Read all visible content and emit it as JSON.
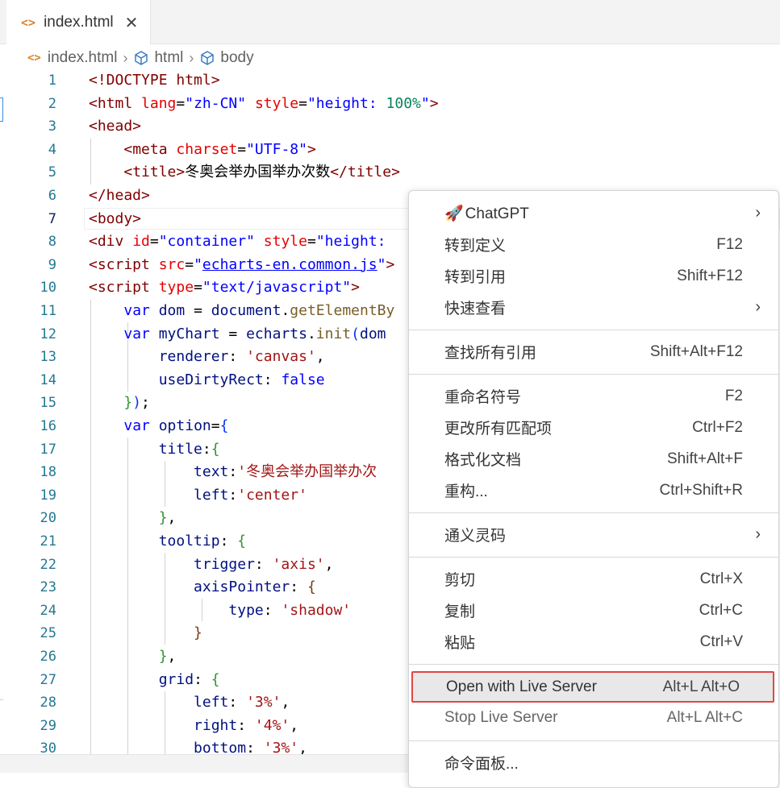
{
  "tab": {
    "icon": "<>",
    "label": "index.html",
    "close": "✕"
  },
  "breadcrumb": {
    "file": "index.html",
    "node1": "html",
    "node2": "body"
  },
  "editor": {
    "lines": [
      {
        "n": "1",
        "tokens": [
          [
            "tag",
            "<!DOCTYPE html>"
          ]
        ]
      },
      {
        "n": "2",
        "tokens": [
          [
            "tag",
            "<html "
          ],
          [
            "attr",
            "lang"
          ],
          [
            "plain",
            "="
          ],
          [
            "str",
            "\"zh-CN\""
          ],
          [
            "plain",
            " "
          ],
          [
            "attr",
            "style"
          ],
          [
            "plain",
            "="
          ],
          [
            "str",
            "\"height: "
          ],
          [
            "num",
            "100%"
          ],
          [
            "str",
            "\""
          ],
          [
            "tag",
            ">"
          ]
        ]
      },
      {
        "n": "3",
        "tokens": [
          [
            "tag",
            "<head>"
          ]
        ]
      },
      {
        "n": "4",
        "tokens": [
          [
            "plain",
            "    "
          ],
          [
            "tag",
            "<meta "
          ],
          [
            "attr",
            "charset"
          ],
          [
            "plain",
            "="
          ],
          [
            "str",
            "\"UTF-8\""
          ],
          [
            "tag",
            ">"
          ]
        ]
      },
      {
        "n": "5",
        "tokens": [
          [
            "plain",
            "    "
          ],
          [
            "tag",
            "<title>"
          ],
          [
            "plain",
            "冬奥会举办国举办次数"
          ],
          [
            "tag",
            "</title>"
          ]
        ]
      },
      {
        "n": "6",
        "tokens": [
          [
            "tag",
            "</head>"
          ]
        ]
      },
      {
        "n": "7",
        "tokens": [
          [
            "tag",
            "<body>"
          ]
        ]
      },
      {
        "n": "8",
        "tokens": [
          [
            "tag",
            "<div "
          ],
          [
            "attr",
            "id"
          ],
          [
            "plain",
            "="
          ],
          [
            "str",
            "\"container\""
          ],
          [
            "plain",
            " "
          ],
          [
            "attr",
            "style"
          ],
          [
            "plain",
            "="
          ],
          [
            "str",
            "\"height:"
          ]
        ]
      },
      {
        "n": "9",
        "tokens": [
          [
            "tag",
            "<script "
          ],
          [
            "attr",
            "src"
          ],
          [
            "plain",
            "="
          ],
          [
            "str",
            "\""
          ],
          [
            "link",
            "echarts-en.common.js"
          ],
          [
            "str",
            "\""
          ],
          [
            "tag",
            ">"
          ]
        ]
      },
      {
        "n": "10",
        "tokens": [
          [
            "tag",
            "<script "
          ],
          [
            "attr",
            "type"
          ],
          [
            "plain",
            "="
          ],
          [
            "str",
            "\"text/javascript\""
          ],
          [
            "tag",
            ">"
          ]
        ]
      },
      {
        "n": "11",
        "tokens": [
          [
            "plain",
            "    "
          ],
          [
            "kw",
            "var"
          ],
          [
            "plain",
            " "
          ],
          [
            "var",
            "dom"
          ],
          [
            "plain",
            " = "
          ],
          [
            "var",
            "document"
          ],
          [
            "plain",
            "."
          ],
          [
            "fn",
            "getElementBy"
          ]
        ]
      },
      {
        "n": "12",
        "tokens": [
          [
            "plain",
            "    "
          ],
          [
            "kw",
            "var"
          ],
          [
            "plain",
            " "
          ],
          [
            "var",
            "myChart"
          ],
          [
            "plain",
            " = "
          ],
          [
            "var",
            "echarts"
          ],
          [
            "plain",
            "."
          ],
          [
            "fn",
            "init"
          ],
          [
            "b1",
            "("
          ],
          [
            "var",
            "dom"
          ]
        ]
      },
      {
        "n": "13",
        "tokens": [
          [
            "plain",
            "        "
          ],
          [
            "var",
            "renderer"
          ],
          [
            "plain",
            ": "
          ],
          [
            "jsstr",
            "'canvas'"
          ],
          [
            "plain",
            ","
          ]
        ]
      },
      {
        "n": "14",
        "tokens": [
          [
            "plain",
            "        "
          ],
          [
            "var",
            "useDirtyRect"
          ],
          [
            "plain",
            ": "
          ],
          [
            "kw",
            "false"
          ]
        ]
      },
      {
        "n": "15",
        "tokens": [
          [
            "plain",
            "    "
          ],
          [
            "b2",
            "}"
          ],
          [
            "b1",
            ")"
          ],
          [
            "plain",
            ";"
          ]
        ]
      },
      {
        "n": "16",
        "tokens": [
          [
            "plain",
            "    "
          ],
          [
            "kw",
            "var"
          ],
          [
            "plain",
            " "
          ],
          [
            "var",
            "option"
          ],
          [
            "plain",
            "="
          ],
          [
            "b1",
            "{"
          ]
        ]
      },
      {
        "n": "17",
        "tokens": [
          [
            "plain",
            "        "
          ],
          [
            "var",
            "title"
          ],
          [
            "plain",
            ":"
          ],
          [
            "b2",
            "{"
          ]
        ]
      },
      {
        "n": "18",
        "tokens": [
          [
            "plain",
            "            "
          ],
          [
            "var",
            "text"
          ],
          [
            "plain",
            ":"
          ],
          [
            "jsstr",
            "'冬奥会举办国举办次"
          ]
        ]
      },
      {
        "n": "19",
        "tokens": [
          [
            "plain",
            "            "
          ],
          [
            "var",
            "left"
          ],
          [
            "plain",
            ":"
          ],
          [
            "jsstr",
            "'center'"
          ]
        ]
      },
      {
        "n": "20",
        "tokens": [
          [
            "plain",
            "        "
          ],
          [
            "b2",
            "}"
          ],
          [
            "plain",
            ","
          ]
        ]
      },
      {
        "n": "21",
        "tokens": [
          [
            "plain",
            "        "
          ],
          [
            "var",
            "tooltip"
          ],
          [
            "plain",
            ": "
          ],
          [
            "b2",
            "{"
          ]
        ]
      },
      {
        "n": "22",
        "tokens": [
          [
            "plain",
            "            "
          ],
          [
            "var",
            "trigger"
          ],
          [
            "plain",
            ": "
          ],
          [
            "jsstr",
            "'axis'"
          ],
          [
            "plain",
            ","
          ]
        ]
      },
      {
        "n": "23",
        "tokens": [
          [
            "plain",
            "            "
          ],
          [
            "var",
            "axisPointer"
          ],
          [
            "plain",
            ": "
          ],
          [
            "b3",
            "{"
          ]
        ]
      },
      {
        "n": "24",
        "tokens": [
          [
            "plain",
            "                "
          ],
          [
            "var",
            "type"
          ],
          [
            "plain",
            ": "
          ],
          [
            "jsstr",
            "'shadow'"
          ]
        ]
      },
      {
        "n": "25",
        "tokens": [
          [
            "plain",
            "            "
          ],
          [
            "b3",
            "}"
          ]
        ]
      },
      {
        "n": "26",
        "tokens": [
          [
            "plain",
            "        "
          ],
          [
            "b2",
            "}"
          ],
          [
            "plain",
            ","
          ]
        ]
      },
      {
        "n": "27",
        "tokens": [
          [
            "plain",
            "        "
          ],
          [
            "var",
            "grid"
          ],
          [
            "plain",
            ": "
          ],
          [
            "b2",
            "{"
          ]
        ]
      },
      {
        "n": "28",
        "tokens": [
          [
            "plain",
            "            "
          ],
          [
            "var",
            "left"
          ],
          [
            "plain",
            ": "
          ],
          [
            "jsstr",
            "'3%'"
          ],
          [
            "plain",
            ","
          ]
        ]
      },
      {
        "n": "29",
        "tokens": [
          [
            "plain",
            "            "
          ],
          [
            "var",
            "right"
          ],
          [
            "plain",
            ": "
          ],
          [
            "jsstr",
            "'4%'"
          ],
          [
            "plain",
            ","
          ]
        ]
      },
      {
        "n": "30",
        "tokens": [
          [
            "plain",
            "            "
          ],
          [
            "var",
            "bottom"
          ],
          [
            "plain",
            ": "
          ],
          [
            "jsstr",
            "'3%'"
          ],
          [
            "plain",
            ","
          ]
        ]
      }
    ],
    "current_line": "7"
  },
  "context_menu": {
    "items": [
      {
        "id": "chatgpt",
        "icon": "🚀",
        "label": "ChatGPT",
        "key": "",
        "submenu": true
      },
      {
        "id": "goto-definition",
        "label": "转到定义",
        "key": "F12"
      },
      {
        "id": "goto-references",
        "label": "转到引用",
        "key": "Shift+F12"
      },
      {
        "id": "peek",
        "label": "快速查看",
        "key": "",
        "submenu": true
      },
      {
        "id": "find-all-references",
        "label": "查找所有引用",
        "key": "Shift+Alt+F12"
      },
      {
        "id": "rename-symbol",
        "label": "重命名符号",
        "key": "F2"
      },
      {
        "id": "change-all-occurrences",
        "label": "更改所有匹配项",
        "key": "Ctrl+F2"
      },
      {
        "id": "format-document",
        "label": "格式化文档",
        "key": "Shift+Alt+F"
      },
      {
        "id": "refactor",
        "label": "重构...",
        "key": "Ctrl+Shift+R"
      },
      {
        "id": "tongyi-lingma",
        "label": "通义灵码",
        "key": "",
        "submenu": true
      },
      {
        "id": "cut",
        "label": "剪切",
        "key": "Ctrl+X"
      },
      {
        "id": "copy",
        "label": "复制",
        "key": "Ctrl+C"
      },
      {
        "id": "paste",
        "label": "粘贴",
        "key": "Ctrl+V"
      },
      {
        "id": "open-live-server",
        "label": "Open with Live Server",
        "key": "Alt+L Alt+O",
        "highlighted": true
      },
      {
        "id": "stop-live-server",
        "label": "Stop Live Server",
        "key": "Alt+L Alt+C",
        "disabled": true
      },
      {
        "id": "command-palette",
        "label": "命令面板...",
        "key": ""
      }
    ],
    "submenu_arrow": "›"
  },
  "colors": {
    "highlight_border": "#e04646",
    "tag": "#800000",
    "attr": "#e50000",
    "string": "#0000ff",
    "js_string": "#a31515",
    "line_number": "#237893"
  }
}
